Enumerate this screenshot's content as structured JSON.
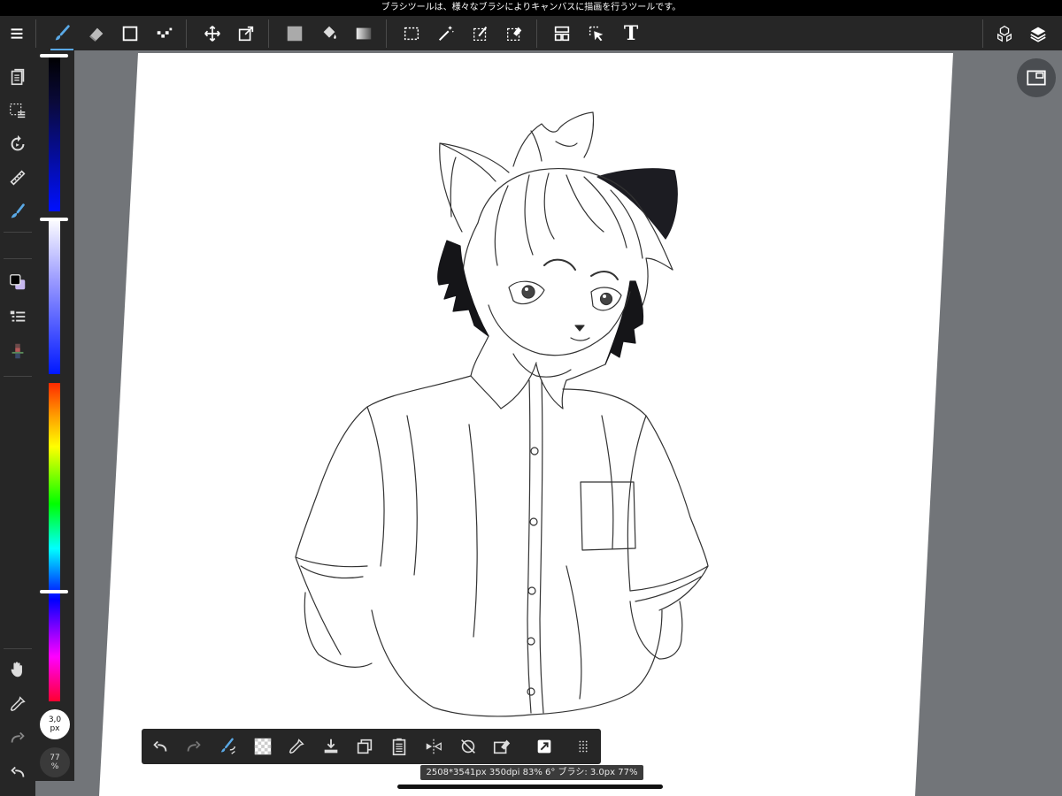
{
  "status_bar": {
    "tooltip": "ブラシツールは、様々なブラシによりキャンバスに描画を行うツールです。"
  },
  "top_toolbar": {
    "tools": [
      {
        "name": "menu",
        "icon": "hamburger-menu-icon"
      },
      {
        "name": "brush",
        "icon": "brush-icon",
        "active": true
      },
      {
        "name": "eraser",
        "icon": "eraser-icon"
      },
      {
        "name": "shape",
        "icon": "rectangle-shape-icon"
      },
      {
        "name": "dot",
        "icon": "dot-brush-icon"
      },
      {
        "name": "move",
        "icon": "move-arrows-icon"
      },
      {
        "name": "transform",
        "icon": "transform-icon"
      },
      {
        "name": "fill-color",
        "icon": "fill-swatch-icon"
      },
      {
        "name": "bucket",
        "icon": "paint-bucket-icon"
      },
      {
        "name": "gradient",
        "icon": "gradient-icon"
      },
      {
        "name": "select",
        "icon": "marquee-select-icon"
      },
      {
        "name": "magic-wand",
        "icon": "magic-wand-icon"
      },
      {
        "name": "select-pen",
        "icon": "select-pen-icon"
      },
      {
        "name": "select-eraser",
        "icon": "select-eraser-icon"
      },
      {
        "name": "frame-divider",
        "icon": "frame-divider-icon"
      },
      {
        "name": "operation",
        "icon": "operation-cursor-icon"
      },
      {
        "name": "text",
        "icon": "text-icon",
        "glyph": "T"
      },
      {
        "name": "3d",
        "icon": "3d-cubes-icon"
      },
      {
        "name": "layers",
        "icon": "layers-icon"
      }
    ]
  },
  "left_sidebar": {
    "items": [
      {
        "name": "page-manager",
        "icon": "pages-icon"
      },
      {
        "name": "selection-list",
        "icon": "selection-list-icon"
      },
      {
        "name": "rotate-canvas",
        "icon": "rotate-icon"
      },
      {
        "name": "ruler",
        "icon": "ruler-icon"
      },
      {
        "name": "brush-settings",
        "icon": "brush-settings-icon"
      },
      {
        "name": "color-swatch",
        "icon": "color-swatch-icon"
      },
      {
        "name": "layer-list",
        "icon": "layer-list-icon"
      },
      {
        "name": "color-palette",
        "icon": "palette-icon"
      },
      {
        "name": "hand",
        "icon": "hand-icon"
      },
      {
        "name": "eyedropper",
        "icon": "eyedropper-icon"
      },
      {
        "name": "redo",
        "icon": "redo-icon"
      },
      {
        "name": "undo",
        "icon": "undo-icon"
      }
    ]
  },
  "color_panel": {
    "brightness_level": 1.0,
    "saturation_level": 1.0,
    "hue_level": 0.66
  },
  "brush": {
    "size_value": "3,0",
    "size_unit": "px",
    "opacity_value": "77",
    "opacity_unit": "%"
  },
  "bottom_toolbar": {
    "items": [
      {
        "name": "undo",
        "icon": "undo-icon"
      },
      {
        "name": "redo",
        "icon": "redo-icon"
      },
      {
        "name": "brush-switch",
        "icon": "brush-swap-icon"
      },
      {
        "name": "transparent-color",
        "icon": "transparency-icon"
      },
      {
        "name": "eyedropper",
        "icon": "eyedropper-icon"
      },
      {
        "name": "save",
        "icon": "save-download-icon"
      },
      {
        "name": "copy",
        "icon": "copy-icon"
      },
      {
        "name": "paste",
        "icon": "paste-icon"
      },
      {
        "name": "flip",
        "icon": "flip-horizontal-icon"
      },
      {
        "name": "snap-off",
        "icon": "snap-off-icon"
      },
      {
        "name": "clear",
        "icon": "clear-layer-icon"
      },
      {
        "name": "material",
        "icon": "material-icon"
      },
      {
        "name": "more",
        "icon": "grid-dots-icon"
      }
    ]
  },
  "info_bar": {
    "text": "2508*3541px 350dpi 83% 6° ブラシ: 3.0px 77%"
  },
  "colors": {
    "toolbar_bg": "#262626",
    "workspace_bg": "#727579",
    "accent": "#5aa9e6",
    "paper": "#ffffff"
  }
}
